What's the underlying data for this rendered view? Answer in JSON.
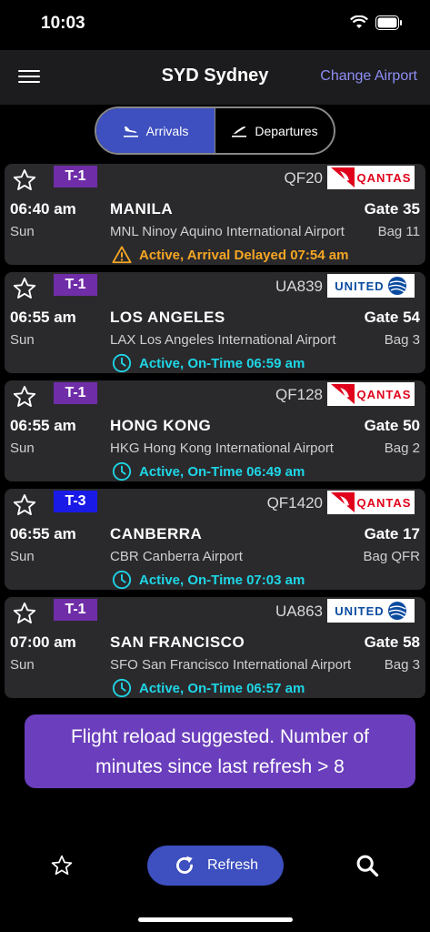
{
  "status_bar": {
    "time": "10:03"
  },
  "nav": {
    "title": "SYD Sydney",
    "action": "Change Airport",
    "menu_icon": "hamburger-menu-icon"
  },
  "segments": [
    {
      "label": "Arrivals",
      "icon": "plane-landing-icon",
      "active": true
    },
    {
      "label": "Departures",
      "icon": "plane-takeoff-icon",
      "active": false
    }
  ],
  "colors": {
    "accent": "#3e4fbf",
    "link": "#8e8ef5",
    "delayed": "#f5a623",
    "on_time": "#1ed6e6",
    "terminal_purple": "#6f2da8",
    "terminal_blue": "#1a1ae6",
    "toast": "#6a3ebc",
    "card": "#2a2a2d"
  },
  "flights": [
    {
      "terminal": "T-1",
      "terminal_color": "#6f2da8",
      "flight_no": "QF20",
      "airline": "QANTAS",
      "time": "06:40 am",
      "day": "Sun",
      "city": "MANILA",
      "gate": "Gate 35",
      "airport": "MNL Ninoy Aquino International Airport",
      "bag": "Bag 11",
      "status": "Active, Arrival Delayed 07:54 am",
      "status_type": "delayed"
    },
    {
      "terminal": "T-1",
      "terminal_color": "#6f2da8",
      "flight_no": "UA839",
      "airline": "UNITED",
      "time": "06:55 am",
      "day": "Sun",
      "city": "LOS ANGELES",
      "gate": "Gate 54",
      "airport": "LAX Los Angeles International Airport",
      "bag": "Bag 3",
      "status": "Active, On-Time 06:59 am",
      "status_type": "on_time"
    },
    {
      "terminal": "T-1",
      "terminal_color": "#6f2da8",
      "flight_no": "QF128",
      "airline": "QANTAS",
      "time": "06:55 am",
      "day": "Sun",
      "city": "HONG KONG",
      "gate": "Gate 50",
      "airport": "HKG Hong Kong International Airport",
      "bag": "Bag 2",
      "status": "Active, On-Time 06:49 am",
      "status_type": "on_time"
    },
    {
      "terminal": "T-3",
      "terminal_color": "#1a1ae6",
      "flight_no": "QF1420",
      "airline": "QANTAS",
      "time": "06:55 am",
      "day": "Sun",
      "city": "CANBERRA",
      "gate": "Gate 17",
      "airport": "CBR Canberra Airport",
      "bag": "Bag QFR",
      "status": "Active, On-Time 07:03 am",
      "status_type": "on_time"
    },
    {
      "terminal": "T-1",
      "terminal_color": "#6f2da8",
      "flight_no": "UA863",
      "airline": "UNITED",
      "time": "07:00 am",
      "day": "Sun",
      "city": "SAN FRANCISCO",
      "gate": "Gate 58",
      "airport": "SFO San Francisco International Airport",
      "bag": "Bag 3",
      "status": "Active, On-Time 06:57 am",
      "status_type": "on_time"
    }
  ],
  "toast": {
    "message": "Flight reload suggested. Number of minutes since last refresh > 8"
  },
  "bottom": {
    "refresh_label": "Refresh",
    "favorites_icon": "star-outline-icon",
    "search_icon": "search-icon",
    "refresh_icon": "refresh-icon"
  }
}
